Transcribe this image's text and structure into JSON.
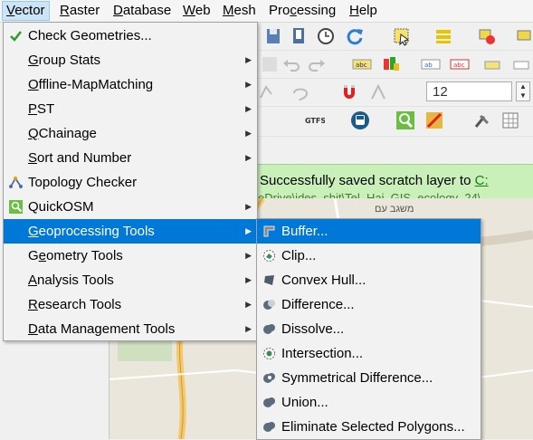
{
  "menubar": {
    "items": [
      {
        "label": "Vector",
        "key": "V",
        "rest": "ector",
        "active": true
      },
      {
        "label": "Raster",
        "key": "R",
        "rest": "aster"
      },
      {
        "label": "Database",
        "key": "D",
        "rest": "atabase"
      },
      {
        "label": "Web",
        "key": "W",
        "rest": "eb"
      },
      {
        "label": "Mesh",
        "key": "M",
        "rest": "esh"
      },
      {
        "label": "Processing",
        "pre": "Pro",
        "key": "c",
        "rest": "essing"
      },
      {
        "label": "Help",
        "key": "H",
        "rest": "elp"
      }
    ]
  },
  "vector_menu": {
    "items": [
      {
        "label": "Check Geometries...",
        "icon": "check-icon",
        "submenu": false
      },
      {
        "label": "Group Stats",
        "key": "G",
        "rest": "roup Stats",
        "submenu": true
      },
      {
        "label": "Offline-MapMatching",
        "key": "O",
        "rest": "ffline-MapMatching",
        "submenu": true
      },
      {
        "label": "PST",
        "key": "P",
        "rest": "ST",
        "submenu": true
      },
      {
        "label": "QChainage",
        "key": "Q",
        "rest": "Chainage",
        "submenu": true
      },
      {
        "label": "Sort and Number",
        "key": "S",
        "rest": "ort and Number",
        "submenu": true
      },
      {
        "label": "Topology Checker",
        "icon": "topology-icon",
        "submenu": false
      },
      {
        "label": "QuickOSM",
        "icon": "quickosm-icon",
        "submenu": true
      },
      {
        "label": "Geoprocessing Tools",
        "key": "G",
        "rest": "eoprocessing Tools",
        "submenu": true,
        "highlight": true
      },
      {
        "label": "Geometry Tools",
        "pre": "G",
        "key": "e",
        "rest": "ometry Tools",
        "submenu": true
      },
      {
        "label": "Analysis Tools",
        "key": "A",
        "rest": "nalysis Tools",
        "submenu": true
      },
      {
        "label": "Research Tools",
        "key": "R",
        "rest": "esearch Tools",
        "submenu": true
      },
      {
        "label": "Data Management Tools",
        "key": "D",
        "rest": "ata Management Tools",
        "submenu": true
      }
    ]
  },
  "geoprocessing_menu": {
    "items": [
      {
        "label": "Buffer...",
        "icon": "buffer-icon",
        "highlight": true
      },
      {
        "label": "Clip...",
        "icon": "clip-icon"
      },
      {
        "label": "Convex Hull...",
        "icon": "convex-hull-icon"
      },
      {
        "label": "Difference...",
        "icon": "difference-icon"
      },
      {
        "label": "Dissolve...",
        "icon": "dissolve-icon"
      },
      {
        "label": "Intersection...",
        "icon": "intersection-icon"
      },
      {
        "label": "Symmetrical Difference...",
        "icon": "symmetrical-difference-icon"
      },
      {
        "label": "Union...",
        "icon": "union-icon"
      },
      {
        "label": "Eliminate Selected Polygons...",
        "icon": "eliminate-polygons-icon"
      }
    ]
  },
  "toolbar": {
    "font_size_value": "12",
    "gtfs_label": "GTFS"
  },
  "message_bar": {
    "text": "Successfully saved scratch layer to ",
    "link": "C:",
    "path_fragment": "eDrive\\ides_shit\\Tel_Hai_GIS_ecology_24\\"
  },
  "map": {
    "label": "משגב עם"
  },
  "colors": {
    "highlight": "#0078d7",
    "menu_bg": "#f2f2f2",
    "message_bg": "#c8f0b8"
  }
}
